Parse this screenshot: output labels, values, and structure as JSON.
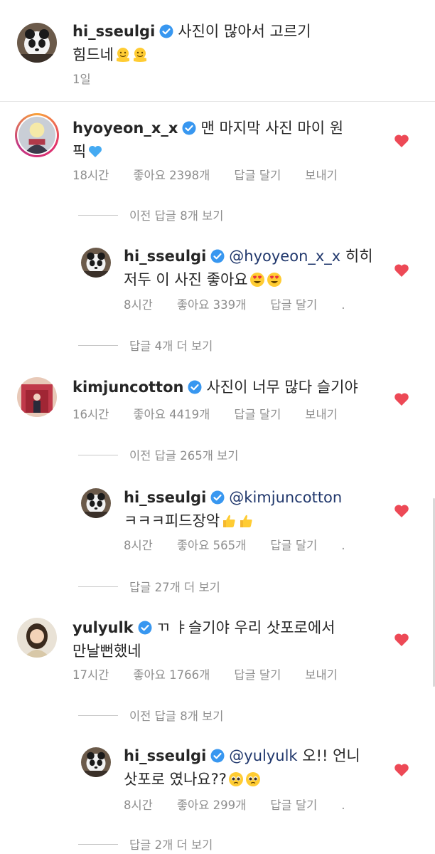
{
  "caption": {
    "username": "hi_sseulgi",
    "text_line1": "사진이 많아서 고르기",
    "text_line2": "힘드네",
    "time": "1일"
  },
  "comments": [
    {
      "username": "hyoyeon_x_x",
      "text_line1": "맨 마지막 사진 마이 원",
      "text_line2": "픽",
      "time": "18시간",
      "likes": "좋아요 2398개",
      "reply": "답글 달기",
      "send": "보내기",
      "view_prev": "이전 답글 8개 보기",
      "sub": {
        "username": "hi_sseulgi",
        "mention": "@hyoyeon_x_x",
        "text_line1": "히히",
        "text_line2": "저두 이 사진 좋아요",
        "time": "8시간",
        "likes": "좋아요 339개",
        "reply": "답글 달기",
        "dot": "."
      },
      "view_more": "답글 4개 더 보기"
    },
    {
      "username": "kimjuncotton",
      "text_line1": "사진이 너무 많다 슬기야",
      "time": "16시간",
      "likes": "좋아요 4419개",
      "reply": "답글 달기",
      "send": "보내기",
      "view_prev": "이전 답글 265개 보기",
      "sub": {
        "username": "hi_sseulgi",
        "mention": "@kimjuncotton",
        "text_line2": "ㅋㅋㅋ피드장악",
        "time": "8시간",
        "likes": "좋아요 565개",
        "reply": "답글 달기",
        "dot": "."
      },
      "view_more": "답글 27개 더 보기"
    },
    {
      "username": "yulyulk",
      "text_line1": "ㄲ ㅑ슬기야 우리 삿포로에서",
      "text_line2": "만날뻔했네",
      "time": "17시간",
      "likes": "좋아요 1766개",
      "reply": "답글 달기",
      "send": "보내기",
      "view_prev": "이전 답글 8개 보기",
      "sub": {
        "username": "hi_sseulgi",
        "mention": "@yulyulk",
        "text_line1": "오!! 언니",
        "text_line2": "삿포로 였나요??",
        "time": "8시간",
        "likes": "좋아요 299개",
        "reply": "답글 달기",
        "dot": "."
      },
      "view_more": "답글 2개 더 보기"
    }
  ],
  "colors": {
    "heart": "#ed4956",
    "verified": "#3897f0",
    "mention": "#20376c",
    "meta": "#8e8e8e"
  },
  "icons": {
    "verified": "verified-badge-icon",
    "heart": "heart-filled-icon",
    "melting_face": "melting-face-emoji",
    "blue_heart": "blue-heart-emoji",
    "heart_eyes": "heart-eyes-emoji",
    "thumbs_up": "thumbs-up-emoji",
    "pleading": "pleading-face-emoji"
  }
}
